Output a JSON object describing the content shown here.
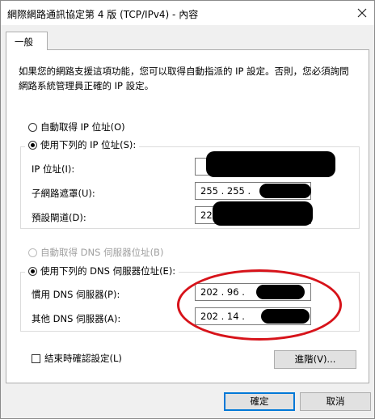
{
  "window": {
    "title": "網際網路通訊協定第 4 版 (TCP/IPv4) - 內容"
  },
  "tab": {
    "label": "一般"
  },
  "description": "如果您的網路支援這項功能，您可以取得自動指派的 IP 設定。否則，您必須詢問網路系統管理員正確的 IP 設定。",
  "ip": {
    "auto_label": "自動取得 IP 位址(O)",
    "manual_label": "使用下列的 IP 位址(S):",
    "address_label": "IP 位址(I):",
    "address_value": "",
    "subnet_label": "子網路遮罩(U):",
    "subnet_value": "255 . 255 .",
    "gateway_label": "預設閘道(D):",
    "gateway_value": "22"
  },
  "dns": {
    "auto_label": "自動取得 DNS 伺服器位址(B)",
    "manual_label": "使用下列的 DNS 伺服器位址(E):",
    "preferred_label": "慣用 DNS 伺服器(P):",
    "preferred_value": "202 . 96 .",
    "alternate_label": "其他 DNS 伺服器(A):",
    "alternate_value": "202 . 14 ."
  },
  "options": {
    "validate_label": "結束時確認設定(L)",
    "advanced_label": "進階(V)..."
  },
  "buttons": {
    "ok": "確定",
    "cancel": "取消"
  },
  "colors": {
    "accent": "#0078d7",
    "annotation": "#d7131a"
  }
}
